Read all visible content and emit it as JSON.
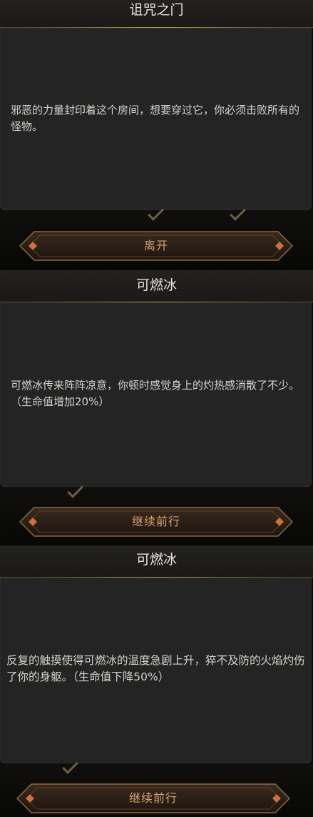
{
  "events": [
    {
      "title": "诅咒之门",
      "description": "邪恶的力量封印着这个房间，想要穿过它，你必须击败所有的怪物。",
      "button_label": "离开"
    },
    {
      "title": "可燃冰",
      "description": "可燃冰传来阵阵凉意，你顿时感觉身上的灼热感消散了不少。（生命值增加20%）",
      "button_label": "继续前行"
    },
    {
      "title": "可燃冰",
      "description": "反复的触摸使得可燃冰的温度急剧上升，猝不及防的火焰灼伤了你的身躯。（生命值下降50%）",
      "button_label": "继续前行"
    }
  ],
  "colors": {
    "button_text": "#d9a070",
    "gold_trim": "#b89a5e",
    "panel": "#242424"
  }
}
